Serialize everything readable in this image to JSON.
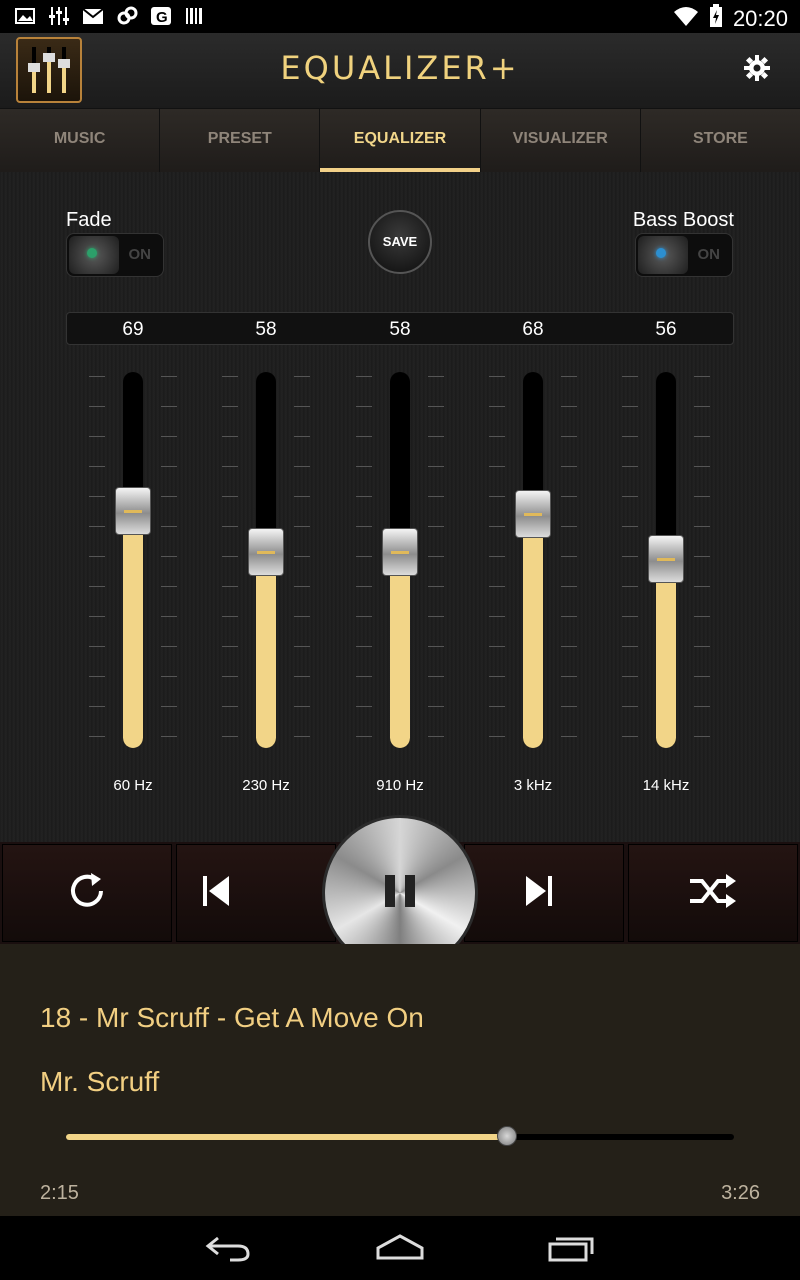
{
  "status_bar": {
    "time": "20:20",
    "left_icons": [
      "image-icon",
      "equalizer-notification-icon",
      "gmail-icon",
      "link-icon",
      "g-icon",
      "barcode-icon"
    ],
    "right_icons": [
      "wifi-icon",
      "battery-charging-icon"
    ]
  },
  "header": {
    "title": "EQUALIZER+",
    "settings_icon": "gear-icon"
  },
  "tabs": [
    {
      "label": "MUSIC",
      "active": false
    },
    {
      "label": "PRESET",
      "active": false
    },
    {
      "label": "EQUALIZER",
      "active": true
    },
    {
      "label": "VISUALIZER",
      "active": false
    },
    {
      "label": "STORE",
      "active": false
    }
  ],
  "equalizer": {
    "fade": {
      "label": "Fade",
      "state": "ON"
    },
    "save_label": "SAVE",
    "bass_boost": {
      "label": "Bass Boost",
      "state": "ON"
    },
    "bands": [
      {
        "value": "69",
        "frequency": "60 Hz",
        "level": 0.69
      },
      {
        "value": "58",
        "frequency": "230 Hz",
        "level": 0.58
      },
      {
        "value": "58",
        "frequency": "910 Hz",
        "level": 0.58
      },
      {
        "value": "68",
        "frequency": "3 kHz",
        "level": 0.68
      },
      {
        "value": "56",
        "frequency": "14 kHz",
        "level": 0.56
      }
    ]
  },
  "controls": {
    "repeat_icon": "repeat-icon",
    "prev_icon": "skip-previous-icon",
    "pause_icon": "pause-icon",
    "next_icon": "skip-next-icon",
    "shuffle_icon": "shuffle-icon"
  },
  "now_playing": {
    "title": "18 - Mr Scruff - Get A Move On",
    "artist": "Mr. Scruff",
    "elapsed": "2:15",
    "total": "3:26",
    "progress": 0.66
  },
  "navbar": {
    "back_icon": "back-icon",
    "home_icon": "home-icon",
    "recents_icon": "recent-apps-icon"
  },
  "colors": {
    "accent": "#f2d588",
    "title_text": "#f2cf82"
  }
}
